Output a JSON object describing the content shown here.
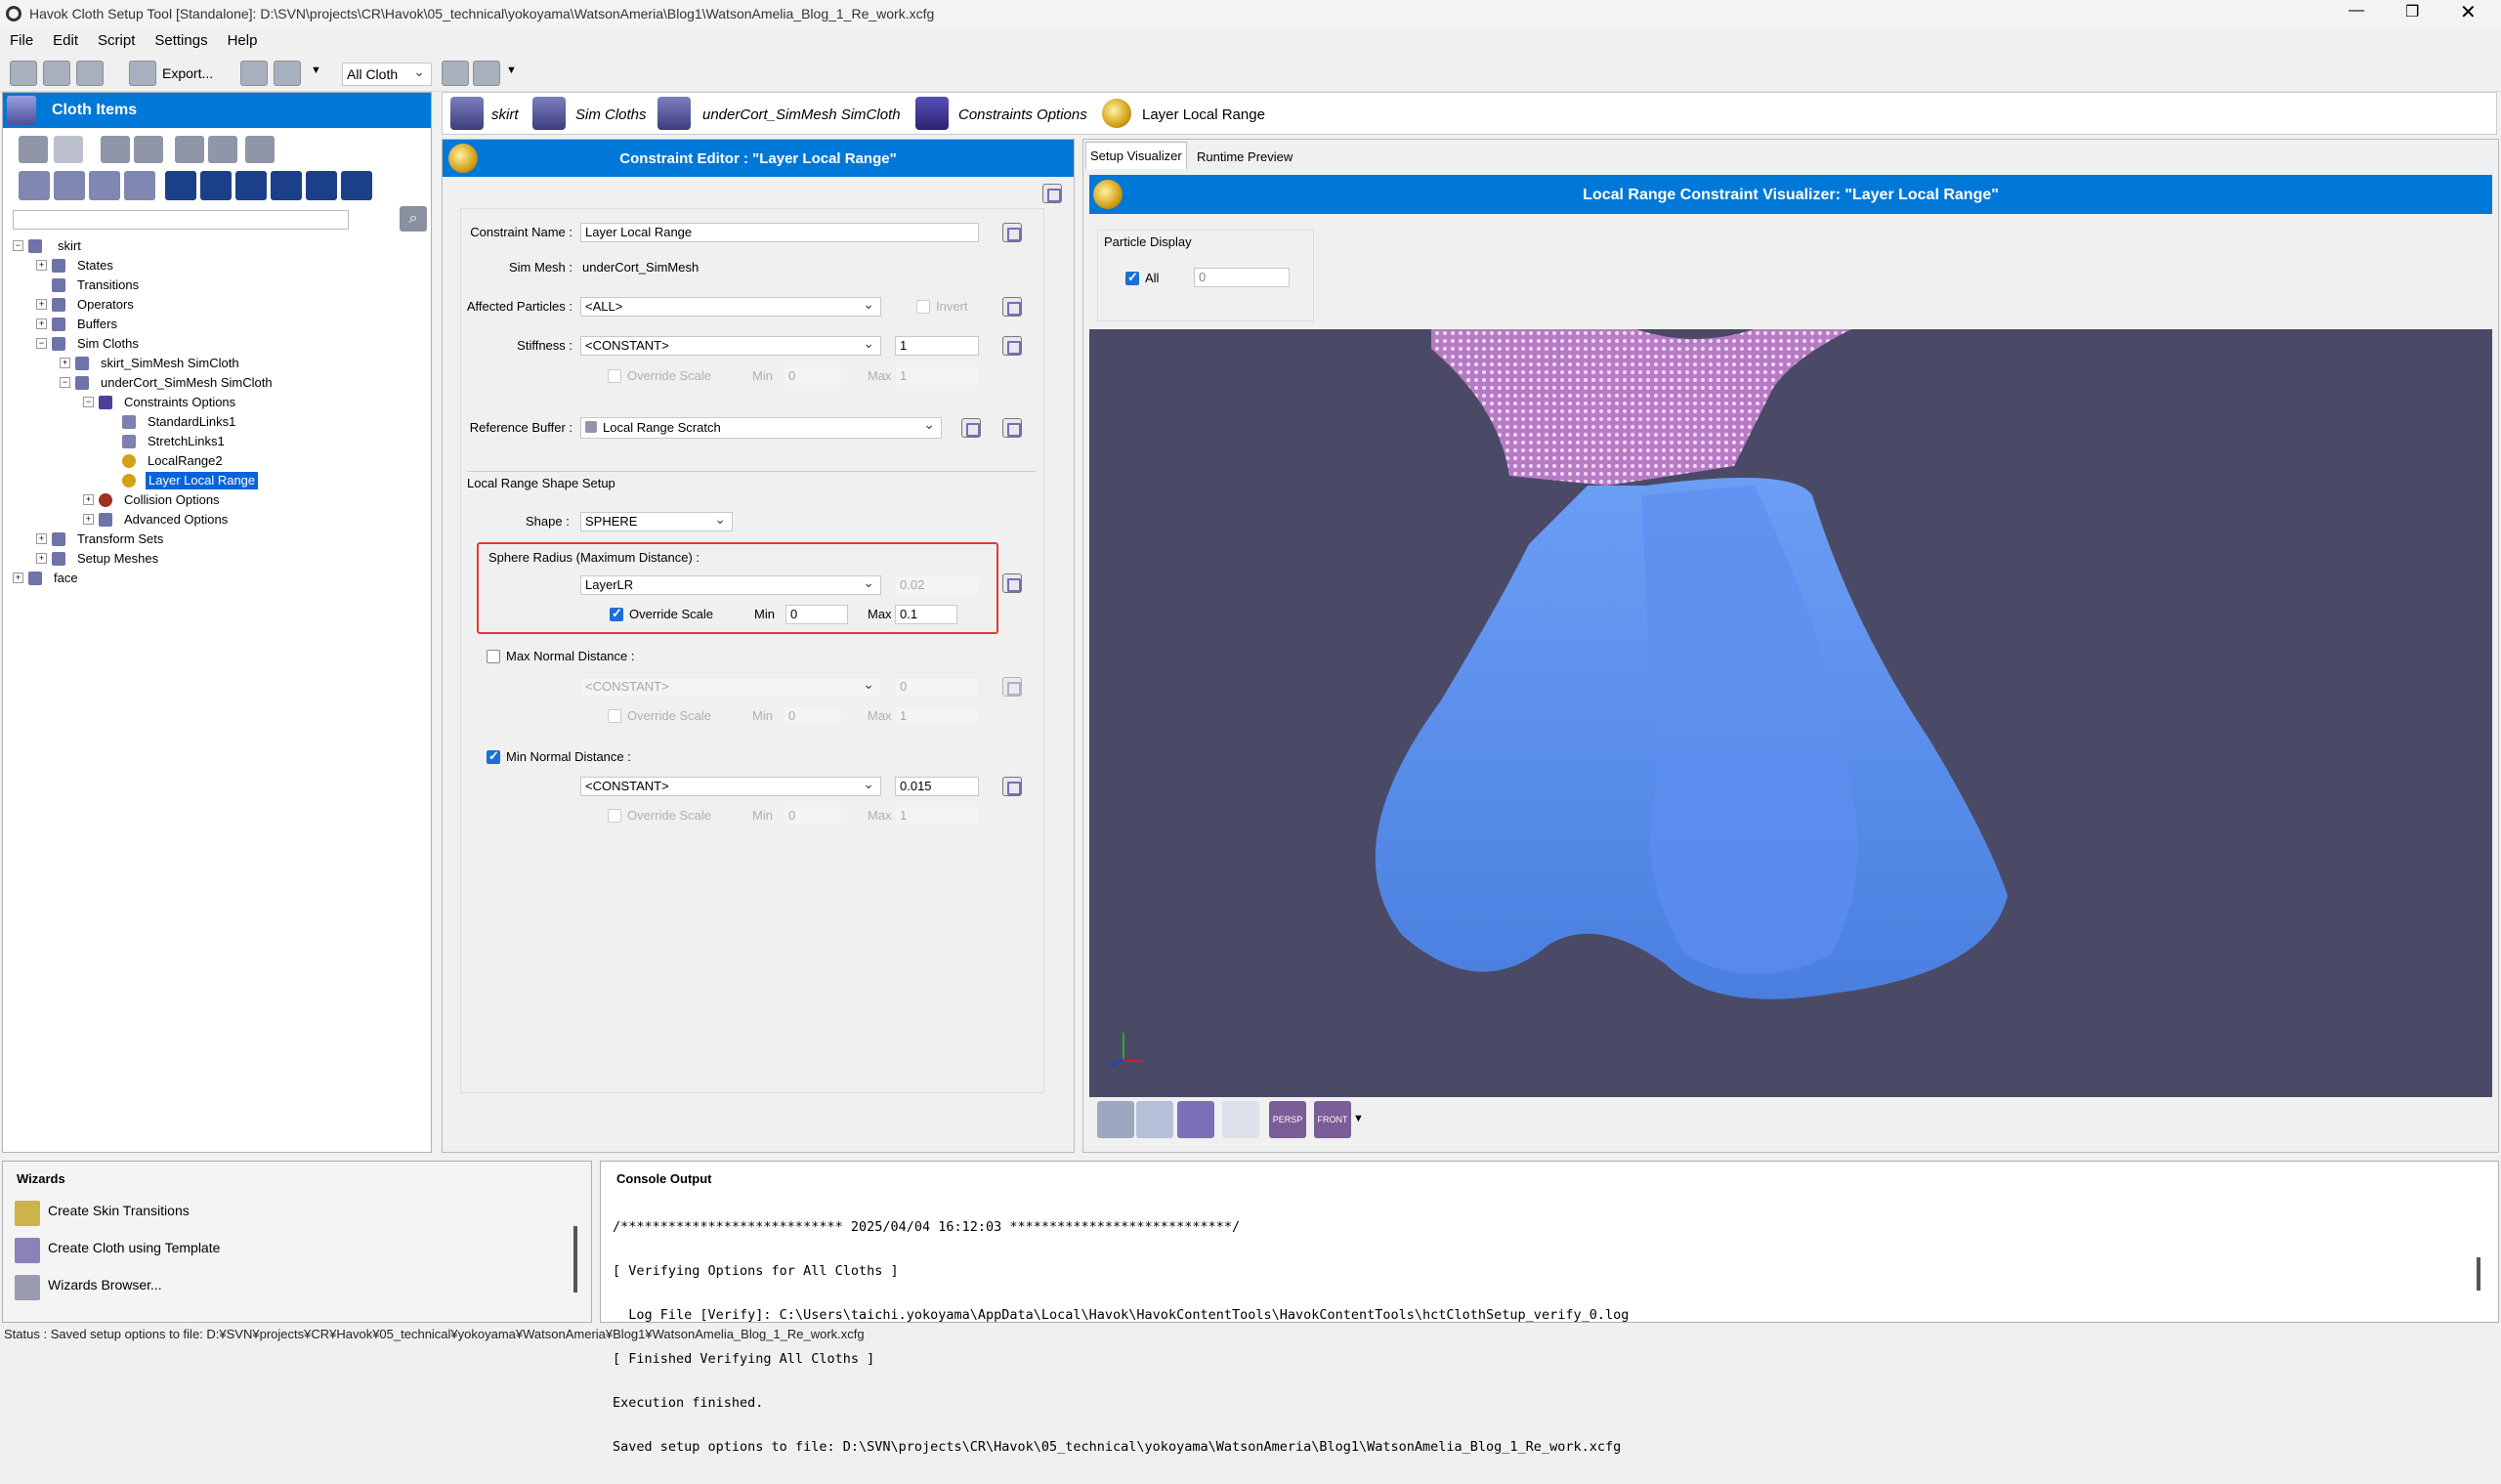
{
  "window": {
    "title": "Havok Cloth Setup Tool [Standalone]: D:\\SVN\\projects\\CR\\Havok\\05_technical\\yokoyama\\WatsonAmeria\\Blog1\\WatsonAmelia_Blog_1_Re_work.xcfg"
  },
  "menu": [
    "File",
    "Edit",
    "Script",
    "Settings",
    "Help"
  ],
  "toolbar": {
    "export_label": "Export...",
    "cloth_filter": "All Cloth"
  },
  "cloth_items": {
    "header": "Cloth Items",
    "tree": [
      {
        "label": "skirt",
        "level": 0
      },
      {
        "label": "States",
        "level": 1
      },
      {
        "label": "Transitions",
        "level": 1
      },
      {
        "label": "Operators",
        "level": 1
      },
      {
        "label": "Buffers",
        "level": 1
      },
      {
        "label": "Sim Cloths",
        "level": 1
      },
      {
        "label": "skirt_SimMesh SimCloth",
        "level": 2
      },
      {
        "label": "underCort_SimMesh SimCloth",
        "level": 2
      },
      {
        "label": "Constraints Options",
        "level": 3
      },
      {
        "label": "StandardLinks1",
        "level": 4
      },
      {
        "label": "StretchLinks1",
        "level": 4
      },
      {
        "label": "LocalRange2",
        "level": 4
      },
      {
        "label": "Layer Local Range",
        "level": 4
      },
      {
        "label": "Collision Options",
        "level": 3
      },
      {
        "label": "Advanced Options",
        "level": 3
      },
      {
        "label": "Transform Sets",
        "level": 1
      },
      {
        "label": "Setup Meshes",
        "level": 1
      },
      {
        "label": "face",
        "level": 0
      }
    ]
  },
  "breadcrumb": [
    "skirt",
    "Sim Cloths",
    "underCort_SimMesh SimCloth",
    "Constraints Options",
    "Layer Local Range"
  ],
  "editor": {
    "title": "Constraint Editor : \"Layer Local Range\"",
    "constraint_name_label": "Constraint Name :",
    "constraint_name": "Layer Local Range",
    "sim_mesh_label": "Sim Mesh :",
    "sim_mesh": "underCort_SimMesh",
    "affected_particles_label": "Affected Particles :",
    "affected_particles": "<ALL>",
    "invert_label": "Invert",
    "stiffness_label": "Stiffness :",
    "stiffness_source": "<CONSTANT>",
    "stiffness_value": "1",
    "override_scale": "Override Scale",
    "min_label": "Min",
    "max_label": "Max",
    "stiffness_min": "0",
    "stiffness_max": "1",
    "reference_buffer_label": "Reference Buffer :",
    "reference_buffer": "Local Range Scratch",
    "shape_setup_label": "Local Range Shape Setup",
    "shape_label": "Shape :",
    "shape": "SPHERE",
    "sphere_radius_label": "Sphere Radius (Maximum Distance) :",
    "sphere_radius_source": "LayerLR",
    "sphere_radius_value": "0.02",
    "sphere_min": "0",
    "sphere_max": "0.1",
    "max_normal_label": "Max Normal Distance :",
    "max_normal_source": "<CONSTANT>",
    "max_normal_value": "0",
    "max_normal_min": "0",
    "max_normal_max": "1",
    "min_normal_label": "Min Normal Distance :",
    "min_normal_source": "<CONSTANT>",
    "min_normal_value": "0.015",
    "min_normal_min": "0",
    "min_normal_max": "1"
  },
  "visualizer": {
    "tabs": [
      "Setup Visualizer",
      "Runtime Preview"
    ],
    "title": "Local Range Constraint Visualizer: \"Layer Local Range\"",
    "particle_display_label": "Particle Display",
    "all_label": "All",
    "particle_value": "0",
    "bottom_buttons": [
      "PERSP",
      "FRONT"
    ]
  },
  "wizards": {
    "header": "Wizards",
    "items": [
      "Create Skin Transitions",
      "Create Cloth using Template",
      "Wizards Browser..."
    ]
  },
  "console": {
    "header": "Console Output",
    "lines": [
      "/**************************** 2025/04/04 16:12:03 ****************************/",
      "[ Verifying Options for All Cloths ]",
      "  Log File [Verify]: C:\\Users\\taichi.yokoyama\\AppData\\Local\\Havok\\HavokContentTools\\HavokContentTools\\hctClothSetup_verify_0.log",
      "[ Finished Verifying All Cloths ]",
      "Execution finished.",
      "Saved setup options to file: D:\\SVN\\projects\\CR\\Havok\\05_technical\\yokoyama\\WatsonAmeria\\Blog1\\WatsonAmelia_Blog_1_Re_work.xcfg"
    ]
  },
  "status": "Status : Saved setup options to file: D:¥SVN¥projects¥CR¥Havok¥05_technical¥yokoyama¥WatsonAmeria¥Blog1¥WatsonAmelia_Blog_1_Re_work.xcfg"
}
